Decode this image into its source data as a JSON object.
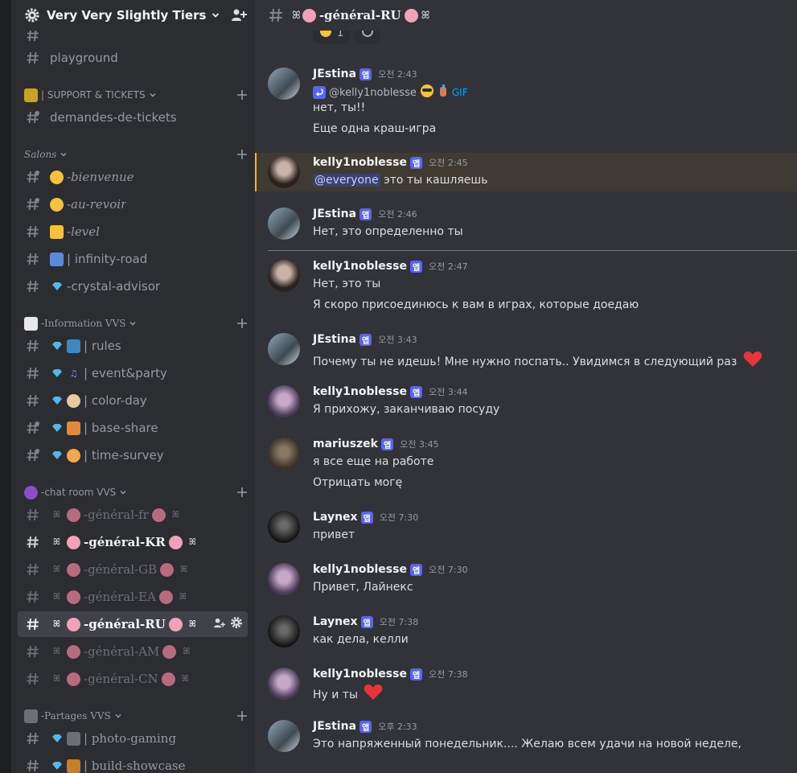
{
  "server": {
    "name": "Very Very Slightly Tiers"
  },
  "channels_top": [
    {
      "label": "playground"
    }
  ],
  "categories": {
    "support": {
      "label": "| SUPPORT & TICKETS"
    },
    "salons": {
      "label": "Salons"
    },
    "information": {
      "label": "-Information VVS"
    },
    "chatroom": {
      "label": "-chat room VVS"
    },
    "partages": {
      "label": "-Partages VVS"
    }
  },
  "support_channels": [
    {
      "label": "demandes-de-tickets"
    }
  ],
  "salons_channels": [
    {
      "label": "-bienvenue"
    },
    {
      "label": "-au-revoir"
    },
    {
      "label": "-level"
    },
    {
      "label": "| infinity-road"
    },
    {
      "label": "-crystal-advisor"
    }
  ],
  "information_channels": [
    {
      "label": "| rules"
    },
    {
      "label": "| event&party"
    },
    {
      "label": "| color-day"
    },
    {
      "label": "| base-share"
    },
    {
      "label": "| time-survey"
    }
  ],
  "chatroom_channels": [
    {
      "label": "-général-fr"
    },
    {
      "label": "-général-KR"
    },
    {
      "label": "-général-GB"
    },
    {
      "label": "-général-EA"
    },
    {
      "label": "-général-RU"
    },
    {
      "label": "-général-AM"
    },
    {
      "label": "-général-CN"
    }
  ],
  "partages_channels": [
    {
      "label": "| photo-gaming"
    },
    {
      "label": "| build-showcase"
    }
  ],
  "header": {
    "channel": "-général-RU"
  },
  "app_tag": "앱",
  "reactions": [
    {
      "count": "1"
    }
  ],
  "messages": [
    {
      "author": "JEstina",
      "time": "오전 2:43",
      "reply_to": "@kelly1noblesse",
      "reply_gif": "GIF",
      "lines": [
        "нет, ты!!",
        "Еще одна краш-игра"
      ]
    },
    {
      "author": "kelly1noblesse",
      "time": "오전 2:45",
      "mention": "@everyone",
      "lines": [
        "это ты кашляешь"
      ]
    },
    {
      "author": "JEstina",
      "time": "오전 2:46",
      "lines": [
        "Нет, это определенно ты"
      ]
    },
    {
      "author": "kelly1noblesse",
      "time": "오전 2:47",
      "lines": [
        "Нет, это ты",
        "Я скоро присоединюсь к вам в играх, которые доедаю"
      ]
    },
    {
      "author": "JEstina",
      "time": "오전 3:43",
      "lines": [
        "Почему ты не идешь! Мне нужно поспать.. Увидимся в следующий раз"
      ]
    },
    {
      "author": "kelly1noblesse",
      "time": "오전 3:44",
      "lines": [
        "Я прихожу, заканчиваю посуду"
      ]
    },
    {
      "author": "mariuszek",
      "time": "오전 3:45",
      "lines": [
        "я все еще на работе",
        "Отрицать могę"
      ]
    },
    {
      "author": "Laynex",
      "time": "오전 7:30",
      "lines": [
        "привет"
      ]
    },
    {
      "author": "kelly1noblesse",
      "time": "오전 7:30",
      "lines": [
        "Привет, Лайнекс"
      ]
    },
    {
      "author": "Laynex",
      "time": "오전 7:38",
      "lines": [
        "как дела, келли"
      ]
    },
    {
      "author": "kelly1noblesse",
      "time": "오전 7:38",
      "lines": [
        "Ну и ты"
      ]
    },
    {
      "author": "JEstina",
      "time": "오후 2:33",
      "lines": [
        "Это напряженный понедельник.... Желаю всем удачи на новой неделе,"
      ]
    }
  ],
  "colors": {
    "accent": "#5865f2",
    "highlight": "#f0b232",
    "new_divider": "#f23f43",
    "heart": "#e8343b"
  }
}
